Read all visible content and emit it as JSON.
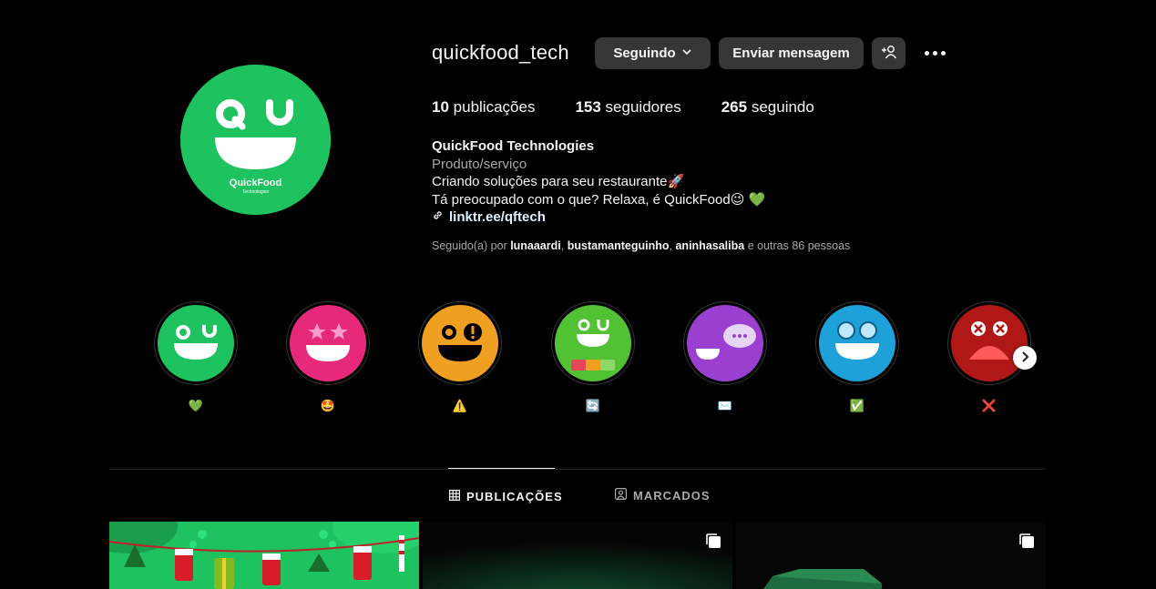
{
  "profile": {
    "username": "quickfood_tech",
    "follow_label": "Seguindo",
    "message_label": "Enviar mensagem",
    "stats": {
      "posts_count": "10",
      "posts_label": "publicações",
      "followers_count": "153",
      "followers_label": "seguidores",
      "following_count": "265",
      "following_label": "seguindo"
    },
    "bio": {
      "name": "QuickFood Technologies",
      "category": "Produto/serviço",
      "line1": "Criando soluções para seu restaurante🚀",
      "line2": "Tá preocupado com o que? Relaxa, é QuickFood😉 💚",
      "link": "linktr.ee/qftech"
    },
    "followed_by": {
      "prefix": "Seguido(a) por",
      "user1": "lunaaardi",
      "user2": "bustamanteguinho",
      "user3": "aninhasaliba",
      "suffix": "e outras 86 pessoas"
    },
    "avatar_brand": "QuickFood",
    "avatar_sub": "Technologies"
  },
  "highlights": [
    {
      "label": "💚",
      "color": "#1ec25f"
    },
    {
      "label": "🤩",
      "color": "#e6297a"
    },
    {
      "label": "⚠️",
      "color": "#f0a020"
    },
    {
      "label": "🔄",
      "color": "#52c234"
    },
    {
      "label": "✉️",
      "color": "#9a3fd0"
    },
    {
      "label": "✅",
      "color": "#1ea0d8"
    },
    {
      "label": "❌",
      "color": "#b01818"
    }
  ],
  "tabs": {
    "posts": "PUBLICAÇÕES",
    "tagged": "MARCADOS"
  },
  "colors": {
    "brand_green": "#1ec25f",
    "button_bg": "#363636",
    "link": "#e0f1ff"
  }
}
